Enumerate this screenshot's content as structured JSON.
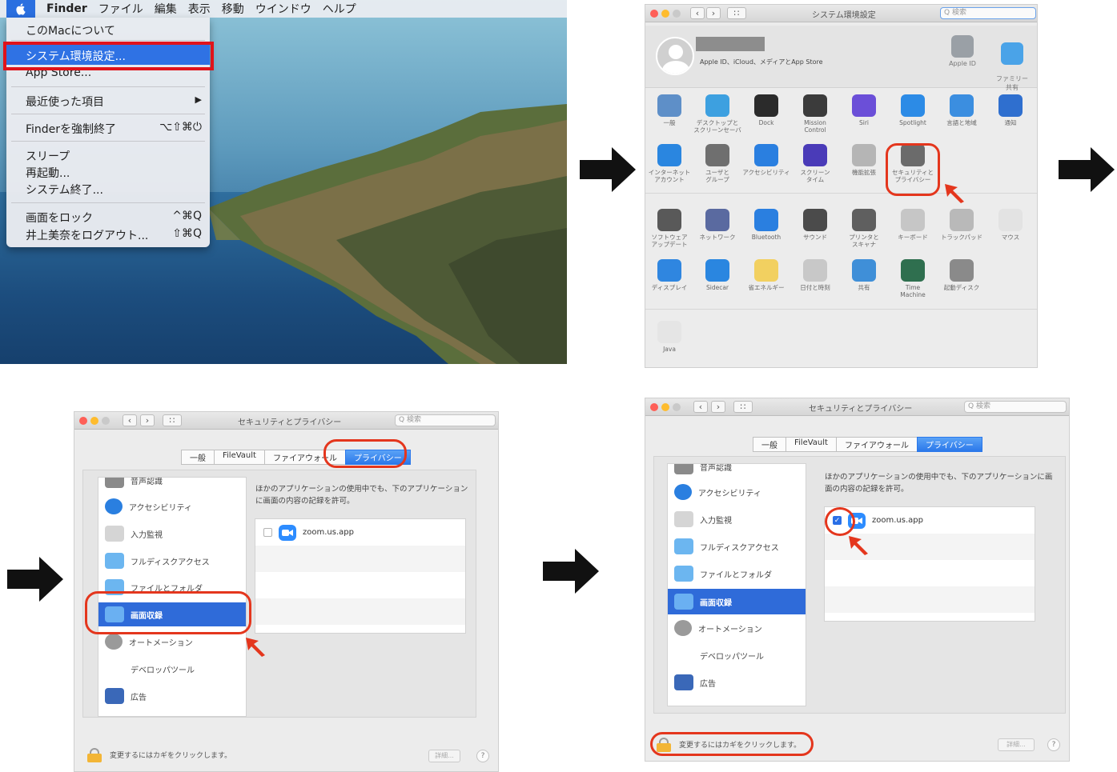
{
  "finder": {
    "menubar": [
      "Finder",
      "ファイル",
      "編集",
      "表示",
      "移動",
      "ウインドウ",
      "ヘルプ"
    ],
    "menu": {
      "about": "このMacについて",
      "system_prefs": "システム環境設定...",
      "app_store": "App Store...",
      "recent": "最近使った項目",
      "recent_arrow": "▶",
      "force_quit": "Finderを強制終了",
      "force_quit_sc": "⌥⇧⌘⏻",
      "sleep": "スリープ",
      "restart": "再起動...",
      "shutdown": "システム終了...",
      "lock": "画面をロック",
      "lock_sc": "^⌘Q",
      "logout": "井上美奈をログアウト...",
      "logout_sc": "⇧⌘Q"
    }
  },
  "sysprefs": {
    "title": "システム環境設定",
    "search_placeholder": "Q 検索",
    "subtitle": "Apple ID、iCloud、メディアとApp Store",
    "top_icons": [
      {
        "label": "Apple ID",
        "color": "#9aa0a6"
      },
      {
        "label": "ファミリー\n共有",
        "color": "#4aa3e8"
      }
    ],
    "rows": [
      [
        {
          "label": "一般",
          "color": "#5e8fc8"
        },
        {
          "label": "デスクトップと\nスクリーンセーバ",
          "color": "#3da0e0"
        },
        {
          "label": "Dock",
          "color": "#2b2b2b"
        },
        {
          "label": "Mission\nControl",
          "color": "#3b3b3b"
        },
        {
          "label": "Siri",
          "color": "#6b4fd8"
        },
        {
          "label": "Spotlight",
          "color": "#2c8be6"
        },
        {
          "label": "言語と地域",
          "color": "#3b8ee0"
        },
        {
          "label": "通知",
          "color": "#2f6fcf"
        }
      ],
      [
        {
          "label": "インターネット\nアカウント",
          "color": "#2a86e0"
        },
        {
          "label": "ユーザと\nグループ",
          "color": "#6f6f6f"
        },
        {
          "label": "アクセシビリティ",
          "color": "#2a7fe0"
        },
        {
          "label": "スクリーン\nタイム",
          "color": "#4a3bb8"
        },
        {
          "label": "機能拡張",
          "color": "#b5b5b5"
        },
        {
          "label": "セキュリティと\nプライバシー",
          "color": "#6b6b6b"
        }
      ],
      [
        {
          "label": "ソフトウェア\nアップデート",
          "color": "#595959"
        },
        {
          "label": "ネットワーク",
          "color": "#5a6aa0"
        },
        {
          "label": "Bluetooth",
          "color": "#2a7fe0"
        },
        {
          "label": "サウンド",
          "color": "#4b4b4b"
        },
        {
          "label": "プリンタと\nスキャナ",
          "color": "#5f5f5f"
        },
        {
          "label": "キーボード",
          "color": "#c6c6c6"
        },
        {
          "label": "トラックパッド",
          "color": "#b9b9b9"
        },
        {
          "label": "マウス",
          "color": "#e3e3e3"
        }
      ],
      [
        {
          "label": "ディスプレイ",
          "color": "#2f86e0"
        },
        {
          "label": "Sidecar",
          "color": "#2a86e0"
        },
        {
          "label": "省エネルギー",
          "color": "#f2d060"
        },
        {
          "label": "日付と時刻",
          "color": "#c8c8c8"
        },
        {
          "label": "共有",
          "color": "#3f8fd8"
        },
        {
          "label": "Time\nMachine",
          "color": "#2f6f4f"
        },
        {
          "label": "起動ディスク",
          "color": "#8a8a8a"
        }
      ],
      [
        {
          "label": "Java",
          "color": "#e5e5e5"
        }
      ]
    ]
  },
  "security1": {
    "title": "セキュリティとプライバシー",
    "search_placeholder": "Q 検索",
    "tabs": [
      "一般",
      "FileVault",
      "ファイアウォール",
      "プライバシー"
    ],
    "sidebar": [
      "音声認識",
      "アクセシビリティ",
      "入力監視",
      "フルディスクアクセス",
      "ファイルとフォルダ",
      "画面収録",
      "オートメーション",
      "デベロッパツール",
      "広告"
    ],
    "selected": "画面収録",
    "description": "ほかのアプリケーションの使用中でも、下のアプリケーションに画面の内容の記録を許可。",
    "app": "zoom.us.app",
    "checked": "false",
    "lock_text": "変更するにはカギをクリックします。",
    "details": "詳細...",
    "help": "?"
  },
  "security2": {
    "title": "セキュリティとプライバシー",
    "search_placeholder": "Q 検索",
    "tabs": [
      "一般",
      "FileVault",
      "ファイアウォール",
      "プライバシー"
    ],
    "sidebar": [
      "音声認識",
      "アクセシビリティ",
      "入力監視",
      "フルディスクアクセス",
      "ファイルとフォルダ",
      "画面収録",
      "オートメーション",
      "デベロッパツール",
      "広告"
    ],
    "selected": "画面収録",
    "description": "ほかのアプリケーションの使用中でも、下のアプリケーションに画面の内容の記録を許可。",
    "app": "zoom.us.app",
    "checked": "true",
    "check_mark": "✓",
    "lock_text": "変更するにはカギをクリックします。",
    "details": "詳細...",
    "help": "?"
  },
  "colors": {
    "highlight": "#2f72e4",
    "annotation_red": "#e4361d",
    "arrow": "#111111"
  }
}
